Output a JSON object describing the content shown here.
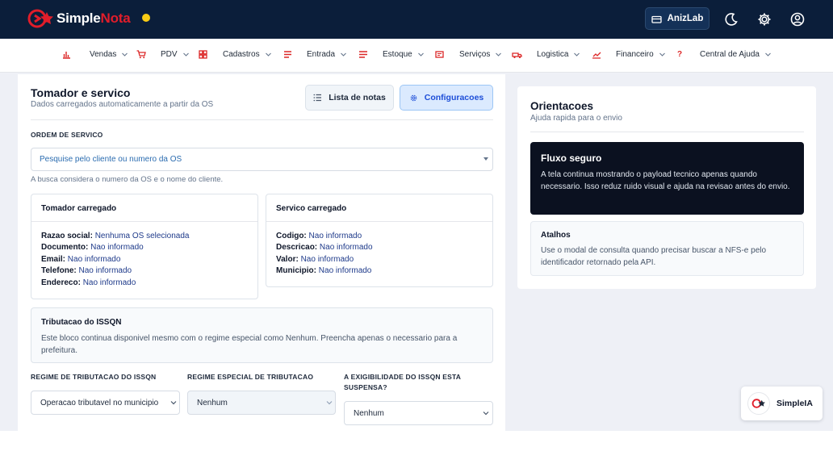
{
  "header": {
    "logo": {
      "prefix": "Simple",
      "accent": "Nota"
    },
    "status_color": "#facc15",
    "company_button": "AnizLab",
    "icons": [
      "building-icon",
      "moon-icon",
      "gear-icon",
      "user-circle-icon"
    ]
  },
  "nav": {
    "items": [
      {
        "label": "Vendas",
        "icon": "bar-chart-icon"
      },
      {
        "label": "PDV",
        "icon": "cart-icon"
      },
      {
        "label": "Cadastros",
        "icon": "grid-icon"
      },
      {
        "label": "Entrada",
        "icon": "lines-icon"
      },
      {
        "label": "Estoque",
        "icon": "lines-icon"
      },
      {
        "label": "Serviços",
        "icon": "ticket-icon"
      },
      {
        "label": "Logistica",
        "icon": "truck-icon"
      },
      {
        "label": "Financeiro",
        "icon": "trend-icon"
      },
      {
        "label": "Central de Ajuda",
        "icon": "question-icon"
      }
    ]
  },
  "main": {
    "title": "Tomador e servico",
    "subtitle": "Dados carregados automaticamente a partir da OS",
    "list_button": "Lista de notas",
    "config_button": "Configuracoes",
    "order_label": "ORDEM DE SERVICO",
    "order_placeholder": "Pesquise pelo cliente ou numero da OS",
    "order_hint": "A busca considera o numero da OS e o nome do cliente.",
    "tomador": {
      "title": "Tomador carregado",
      "rows": [
        {
          "key": "Razao social:",
          "value": "Nenhuma OS selecionada"
        },
        {
          "key": "Documento:",
          "value": "Nao informado"
        },
        {
          "key": "Email:",
          "value": "Nao informado"
        },
        {
          "key": "Telefone:",
          "value": "Nao informado"
        },
        {
          "key": "Endereco:",
          "value": "Nao informado"
        }
      ]
    },
    "servico": {
      "title": "Servico carregado",
      "rows": [
        {
          "key": "Codigo:",
          "value": "Nao informado"
        },
        {
          "key": "Descricao:",
          "value": "Nao informado"
        },
        {
          "key": "Valor:",
          "value": "Nao informado"
        },
        {
          "key": "Municipio:",
          "value": "Nao informado"
        }
      ]
    },
    "tributacao": {
      "title": "Tributacao do ISSQN",
      "text": "Este bloco continua disponivel mesmo com o regime especial como Nenhum. Preencha apenas o necessario para a prefeitura."
    },
    "fields": {
      "regime_label": "REGIME DE TRIBUTACAO DO ISSQN",
      "regime_value": "Operacao tributavel no municipio",
      "especial_label": "REGIME ESPECIAL DE TRIBUTACAO",
      "especial_value": "Nenhum",
      "exigibilidade_label": "A EXIGIBILIDADE DO ISSQN ESTA SUSPENSA?",
      "exigibilidade_value": "Nenhum"
    }
  },
  "side": {
    "title": "Orientacoes",
    "subtitle": "Ajuda rapida para o envio",
    "dark_title": "Fluxo seguro",
    "dark_text": "A tela continua mostrando o payload tecnico apenas quando necessario. Isso reduz ruido visual e ajuda na revisao antes do envio.",
    "light_title": "Atalhos",
    "light_text": "Use o modal de consulta quando precisar buscar a NFS-e pelo identificador retornado pela API."
  },
  "assistant": {
    "label": "SimpleIA"
  },
  "colors": {
    "brand_red": "#e11d2a",
    "header_bg": "#0b1e3a",
    "accent_blue": "#1d4ed8"
  }
}
